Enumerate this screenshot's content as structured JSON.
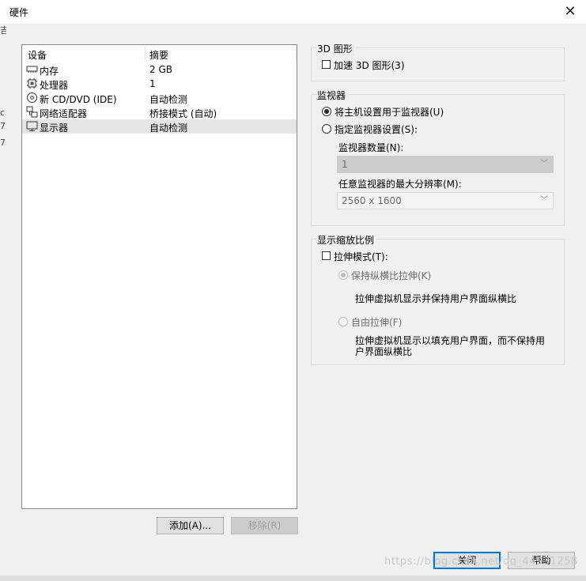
{
  "window": {
    "title": "硬件",
    "close_glyph": "✕"
  },
  "background_fragments": [
    "吉",
    "c",
    "7",
    "7"
  ],
  "device_list": {
    "columns": [
      "设备",
      "摘要"
    ],
    "rows": [
      {
        "icon": "memory-icon",
        "name": "内存",
        "summary": "2 GB",
        "selected": false
      },
      {
        "icon": "processor-icon",
        "name": "处理器",
        "summary": "1",
        "selected": false
      },
      {
        "icon": "cd-dvd-icon",
        "name": "新 CD/DVD (IDE)",
        "summary": "自动检测",
        "selected": false
      },
      {
        "icon": "network-adapter-icon",
        "name": "网络适配器",
        "summary": "桥接模式 (自动)",
        "selected": false
      },
      {
        "icon": "display-icon",
        "name": "显示器",
        "summary": "自动检测",
        "selected": true
      }
    ]
  },
  "buttons": {
    "add": "添加(A)...",
    "remove": "移除(R)",
    "close": "关闭",
    "help": "帮助"
  },
  "graphics_3d": {
    "title": "3D 图形",
    "accelerate_label": "加速 3D 图形(3)",
    "accelerate_checked": false
  },
  "monitor": {
    "title": "监视器",
    "use_host_label": "将主机设置用于监视器(U)",
    "use_host_selected": true,
    "specify_label": "指定监视器设置(S):",
    "specify_selected": false,
    "count_label": "监视器数量(N):",
    "count_value": "1",
    "max_res_label": "任意监视器的最大分辨率(M):",
    "max_res_value": "2560 x 1600"
  },
  "scaling": {
    "title": "显示缩放比例",
    "stretch_label": "拉伸模式(T):",
    "stretch_checked": false,
    "keep_aspect_label": "保持纵横比拉伸(K)",
    "keep_aspect_selected": true,
    "keep_aspect_desc": "拉伸虚拟机显示并保持用户界面纵横比",
    "free_label": "自由拉伸(F)",
    "free_selected": false,
    "free_desc_line1": "拉伸虚拟机显示以填充用户界面，而不保持用",
    "free_desc_line2": "户界面纵横比"
  },
  "watermark": "https://blog.csdn.net/qq_44931258",
  "colors": {
    "selection": "#e5e5e5",
    "default_button_border": "#0078d7",
    "dialog_bg": "#f0f0f0"
  }
}
